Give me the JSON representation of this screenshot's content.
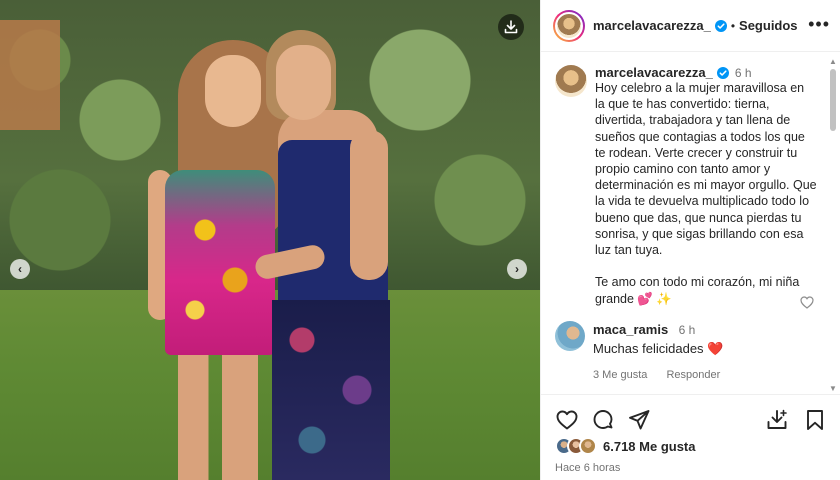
{
  "post": {
    "username": "marcelavacarezza_",
    "verified": true,
    "follow_status": "Seguidos",
    "separator": "•",
    "caption_time": "6 h",
    "caption": "Hoy celebro a la mujer maravillosa en la que te has convertido: tierna, divertida, trabajadora y tan llena de sueños que contagias a todos los que te rodean. Verte crecer y construir tu propio camino con tanto amor y determinación es mi mayor orgullo. Que la vida te devuelva multiplicado todo lo bueno que das, que nunca pierdas tu sonrisa, y que sigas brillando con esa luz tan tuya.\n\nTe amo con todo mi corazón, mi niña grande 💕 ✨",
    "likes": "6.718 Me gusta",
    "posted_ago": "Hace 6 horas",
    "more_icon": "•••"
  },
  "comments": [
    {
      "username": "maca_ramis",
      "time": "6 h",
      "text": "Muchas felicidades ❤️",
      "likes": "3 Me gusta",
      "reply": "Responder"
    }
  ],
  "media": {
    "prev_glyph": "‹",
    "next_glyph": "›"
  },
  "icons": {
    "download": "download-icon",
    "like": "heart-icon",
    "comment": "comment-icon",
    "share": "share-icon",
    "save_image": "save-image-icon",
    "bookmark": "bookmark-icon"
  },
  "colors": {
    "verified_blue": "#0095f6",
    "text_primary": "#262626",
    "text_secondary": "#737373"
  }
}
